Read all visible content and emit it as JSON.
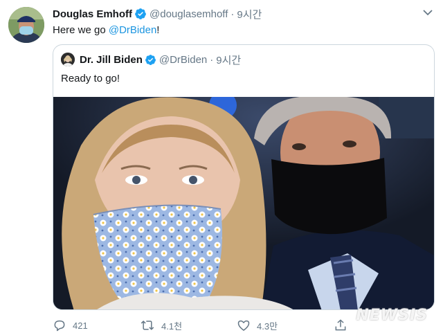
{
  "tweet": {
    "author_name": "Douglas Emhoff",
    "author_handle": "@douglasemhoff",
    "separator": "·",
    "time": "9시간",
    "text_prefix": "Here we go ",
    "mention": "@DrBiden",
    "text_suffix": "!"
  },
  "quoted_tweet": {
    "author_name": "Dr. Jill Biden",
    "author_handle": "@DrBiden",
    "separator": "·",
    "time": "9시간",
    "text": "Ready to go!"
  },
  "actions": {
    "reply_count": "421",
    "retweet_count": "4.1천",
    "like_count": "4.3만"
  },
  "icons": {
    "verified": "verified-badge-icon",
    "caret": "chevron-down-icon",
    "reply": "reply-icon",
    "retweet": "retweet-icon",
    "like": "heart-icon",
    "share": "share-icon"
  },
  "colors": {
    "link": "#1b95e0",
    "secondary_text": "#657786",
    "border": "#ccd6dd",
    "verified": "#1da1f2"
  },
  "watermark": "NEWSIS"
}
